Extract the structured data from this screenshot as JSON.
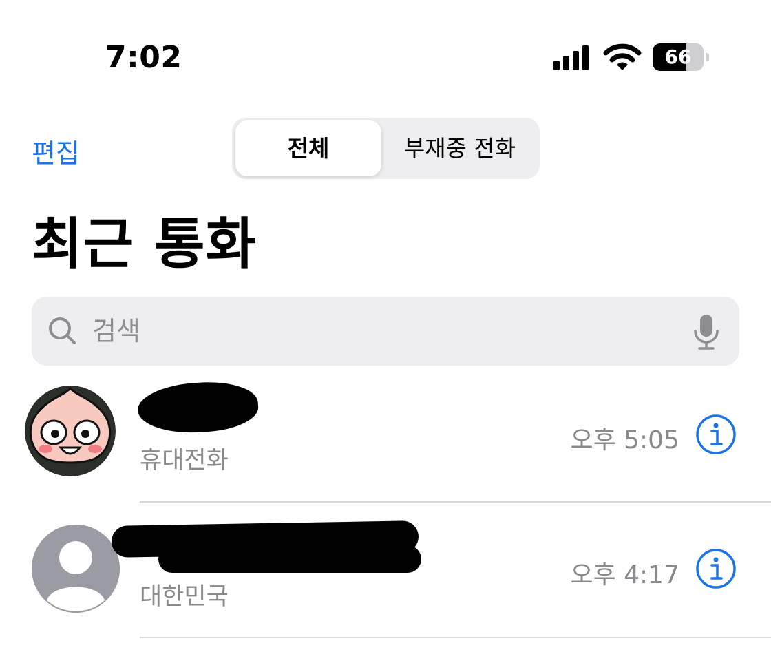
{
  "status_bar": {
    "time": "7:02",
    "battery": "66",
    "battery_level": 0.66
  },
  "nav": {
    "edit_label": "편집",
    "segments": [
      "전체",
      "부재중 전화"
    ],
    "selected_segment": "전체"
  },
  "title": "최근 통화",
  "search": {
    "placeholder": "검색"
  },
  "calls": [
    {
      "label": "휴대전화",
      "time": "오후 5:05"
    },
    {
      "label": "대한민국",
      "time": "오후 4:17"
    }
  ],
  "colors": {
    "accent": "#1a73e8",
    "secondary_text": "#8a8a8e",
    "search_bg": "#eeeef0"
  }
}
